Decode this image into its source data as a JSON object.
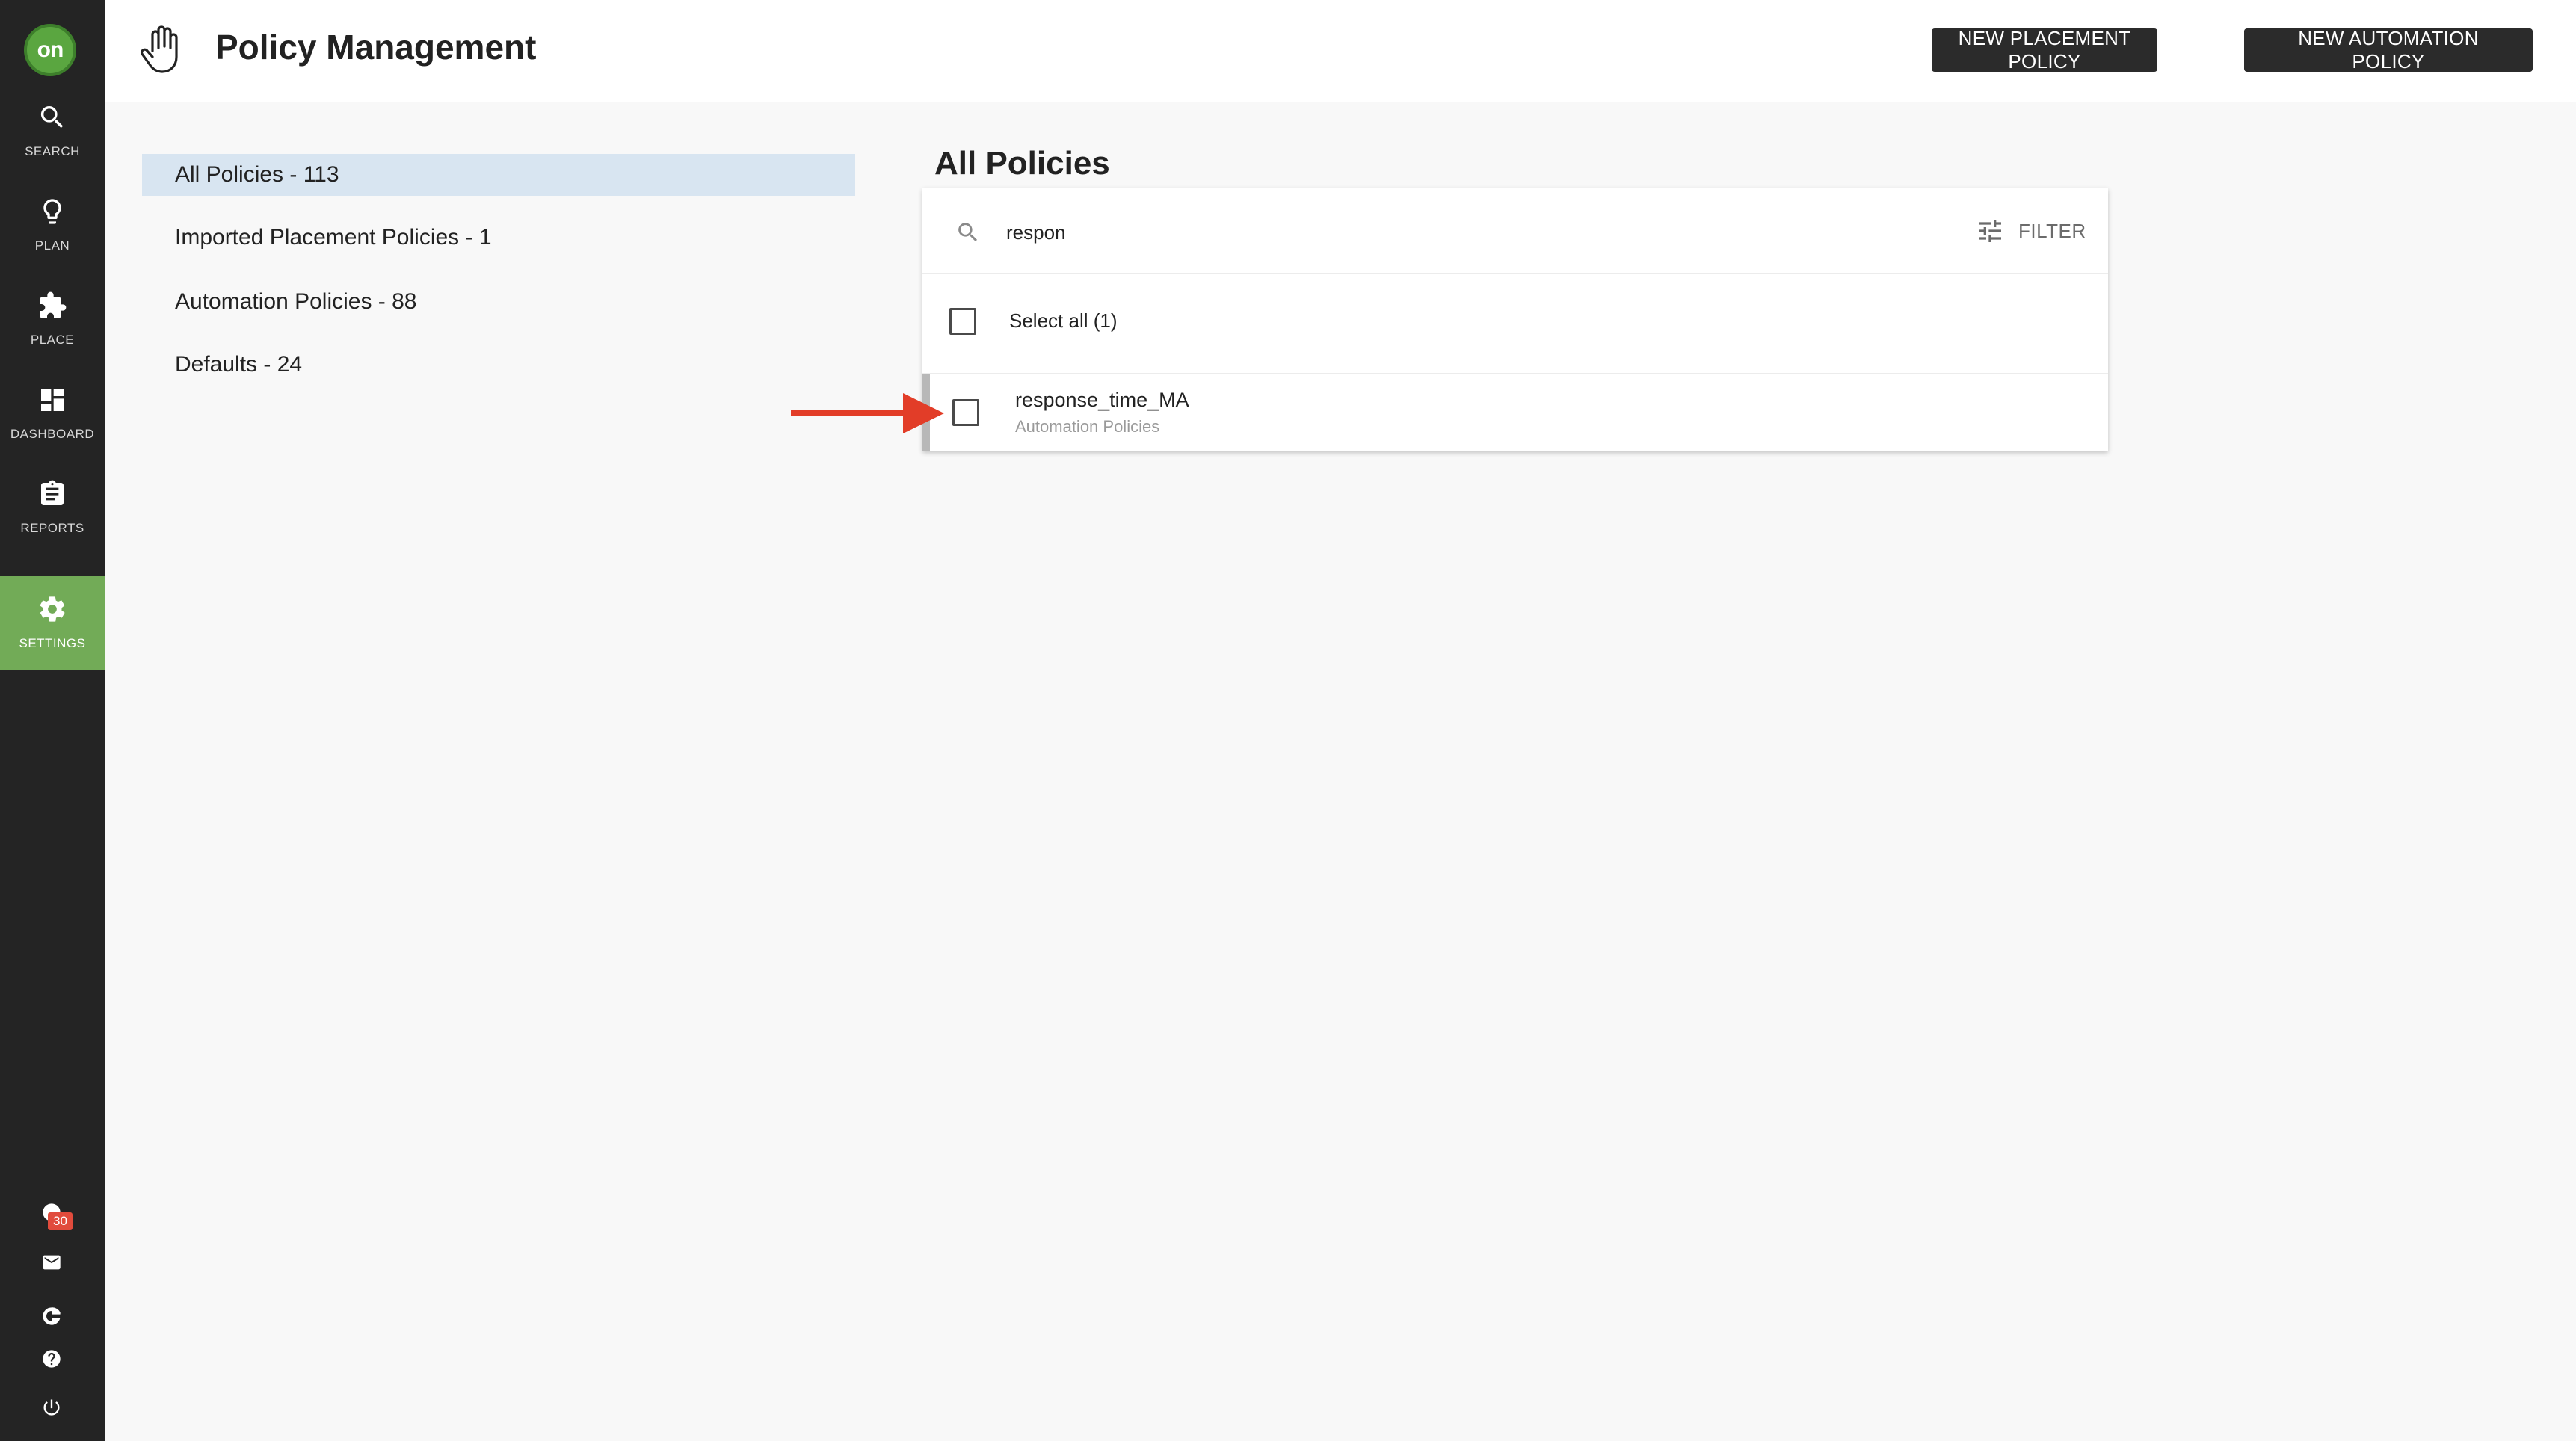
{
  "sidebar": {
    "logo": "on",
    "items": [
      {
        "label": "SEARCH",
        "icon": "search-icon"
      },
      {
        "label": "PLAN",
        "icon": "lightbulb-icon"
      },
      {
        "label": "PLACE",
        "icon": "puzzle-icon"
      },
      {
        "label": "DASHBOARD",
        "icon": "dashboard-icon"
      },
      {
        "label": "REPORTS",
        "icon": "clipboard-icon"
      },
      {
        "label": "SETTINGS",
        "icon": "gear-icon",
        "active": true
      }
    ],
    "notifications_count": "30",
    "bottom_icons": [
      "notification-icon",
      "mail-icon",
      "g-icon",
      "help-icon",
      "power-icon"
    ]
  },
  "header": {
    "title": "Policy Management",
    "icon": "hand-icon",
    "new_placement_label": "NEW PLACEMENT POLICY",
    "new_automation_label": "NEW AUTOMATION POLICY"
  },
  "categories": [
    {
      "label": "All Policies - 113",
      "active": true
    },
    {
      "label": "Imported Placement Policies - 1"
    },
    {
      "label": "Automation Policies - 88"
    },
    {
      "label": "Defaults - 24"
    }
  ],
  "main": {
    "title": "All Policies",
    "search": {
      "value": "respon",
      "icon": "search-icon"
    },
    "filter_label": "FILTER",
    "select_all_label": "Select all (1)",
    "results": [
      {
        "name": "response_time_MA",
        "category": "Automation Policies"
      }
    ]
  },
  "annotation": {
    "color": "#e23d28",
    "icon": "red-arrow"
  },
  "colors": {
    "sidebar_bg": "#242424",
    "active_nav": "#72ab57",
    "selected_category": "#d8e5f1",
    "button_bg": "#2b2b2b"
  }
}
